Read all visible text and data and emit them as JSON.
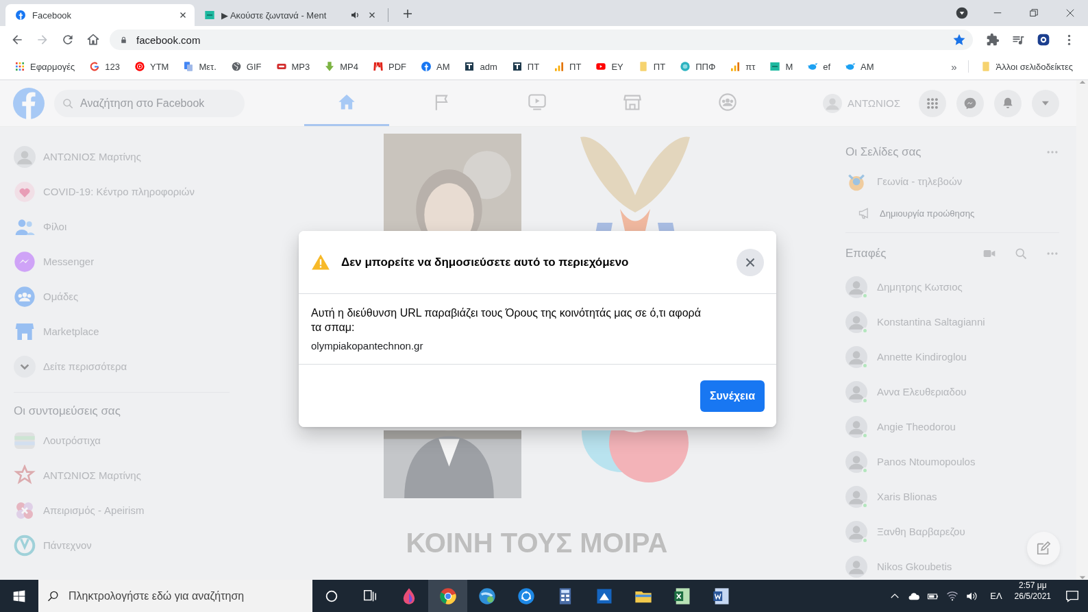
{
  "browser": {
    "tabs": [
      {
        "title": "Facebook",
        "kind": "fb",
        "selected": true,
        "audio": false
      },
      {
        "title": "▶ Ακούστε ζωντανά - Ment",
        "kind": "tileteal",
        "selected": false,
        "audio": true
      }
    ],
    "address": "facebook.com",
    "bookmarks": [
      {
        "label": "Εφαρμογές",
        "kind": "grid"
      },
      {
        "label": "123",
        "kind": "gswirl"
      },
      {
        "label": "YTM",
        "kind": "playred"
      },
      {
        "label": "Μετ.",
        "kind": "docblue"
      },
      {
        "label": "GIF",
        "kind": "globe"
      },
      {
        "label": "MP3",
        "kind": "pillred"
      },
      {
        "label": "MP4",
        "kind": "arrowgreen"
      },
      {
        "label": "PDF",
        "kind": "pdf"
      },
      {
        "label": "AM",
        "kind": "fb"
      },
      {
        "label": "adm",
        "kind": "tiledark"
      },
      {
        "label": "ΠΤ",
        "kind": "tiledark"
      },
      {
        "label": "ΠΤ",
        "kind": "bars"
      },
      {
        "label": "ΕΥ",
        "kind": "youtube"
      },
      {
        "label": "ΠΤ",
        "kind": "folder"
      },
      {
        "label": "ΠΠΦ",
        "kind": "circleteal"
      },
      {
        "label": "πτ",
        "kind": "bars"
      },
      {
        "label": "M",
        "kind": "tileteal"
      },
      {
        "label": "ef",
        "kind": "bird"
      },
      {
        "label": "AM",
        "kind": "bird"
      }
    ],
    "overflow": "»",
    "other_bookmarks": "Άλλοι σελιδοδείκτες"
  },
  "facebook": {
    "search_placeholder": "Αναζήτηση στο Facebook",
    "nav": [
      {
        "kind": "home",
        "selected": true
      },
      {
        "kind": "flag",
        "selected": false
      },
      {
        "kind": "video",
        "selected": false
      },
      {
        "kind": "store",
        "selected": false
      },
      {
        "kind": "groups",
        "selected": false
      }
    ],
    "profile_name": "ΑΝΤΩΝΙΟΣ",
    "menu": [
      {
        "label": "ΑΝΤΩΝΙΟΣ Μαρτίνης",
        "kind": "avatar"
      },
      {
        "label": "COVID-19: Κέντρο πληροφοριών",
        "kind": "covid"
      },
      {
        "label": "Φίλοι",
        "kind": "friends"
      },
      {
        "label": "Messenger",
        "kind": "messengerc"
      },
      {
        "label": "Ομάδες",
        "kind": "groupsc"
      },
      {
        "label": "Marketplace",
        "kind": "market"
      },
      {
        "label": "Δείτε περισσότερα",
        "kind": "chevronc"
      }
    ],
    "shortcuts_title": "Οι συντομεύσεις σας",
    "shortcuts": [
      {
        "label": "Λουτρόστιχα",
        "kind": "stripes"
      },
      {
        "label": "ΑΝΤΩΝΙΟΣ Μαρτίνης",
        "kind": "starred"
      },
      {
        "label": "Απειρισμός - Apeirism",
        "kind": "flower"
      },
      {
        "label": "Πάντεχνον",
        "kind": "emblem"
      }
    ],
    "post": {
      "headline": "ΚΟΙΝΗ ΤΟΥΣ ΜΟΙΡΑ"
    },
    "pages_title": "Οι Σελίδες σας",
    "page_name": "Γεωνία - τηλεβοών",
    "promote": "Δημιουργία προώθησης",
    "contacts_title": "Επαφές",
    "contacts": [
      {
        "name": "Δημητρης Κωτσιος",
        "online": true
      },
      {
        "name": "Konstantina Saltagianni",
        "online": true
      },
      {
        "name": "Annette Kindiroglou",
        "online": true
      },
      {
        "name": "Αννα Ελευθεριαδου",
        "online": true
      },
      {
        "name": "Angie Theodorou",
        "online": true
      },
      {
        "name": "Panos Ntoumopoulos",
        "online": true
      },
      {
        "name": "Xaris Blionas",
        "online": true
      },
      {
        "name": "Ξανθη Βαρβαρεζου",
        "online": true
      },
      {
        "name": "Nikos Gkoubetis",
        "online": false
      }
    ]
  },
  "dialog": {
    "title": "Δεν μπορείτε να δημοσιεύσετε αυτό το περιεχόμενο",
    "message": "Αυτή η διεύθυνση URL παραβιάζει τους Όρους της κοινότητάς μας σε ό,τι αφορά τα σπαμ:",
    "url": "olympiakopantechnon.gr",
    "button": "Συνέχεια"
  },
  "taskbar": {
    "search_placeholder": "Πληκτρολογήστε εδώ για αναζήτηση",
    "apps": [
      {
        "kind": "drop",
        "selected": false
      },
      {
        "kind": "chrome",
        "selected": true
      },
      {
        "kind": "edgeglobe",
        "selected": false
      },
      {
        "kind": "network",
        "selected": false
      },
      {
        "kind": "calc",
        "selected": false
      },
      {
        "kind": "appblue",
        "selected": false
      },
      {
        "kind": "folderf",
        "selected": false
      },
      {
        "kind": "excel",
        "selected": false
      },
      {
        "kind": "word",
        "selected": false
      }
    ],
    "language": "ΕΛ",
    "time": "2:57 μμ",
    "date": "26/5/2021"
  }
}
